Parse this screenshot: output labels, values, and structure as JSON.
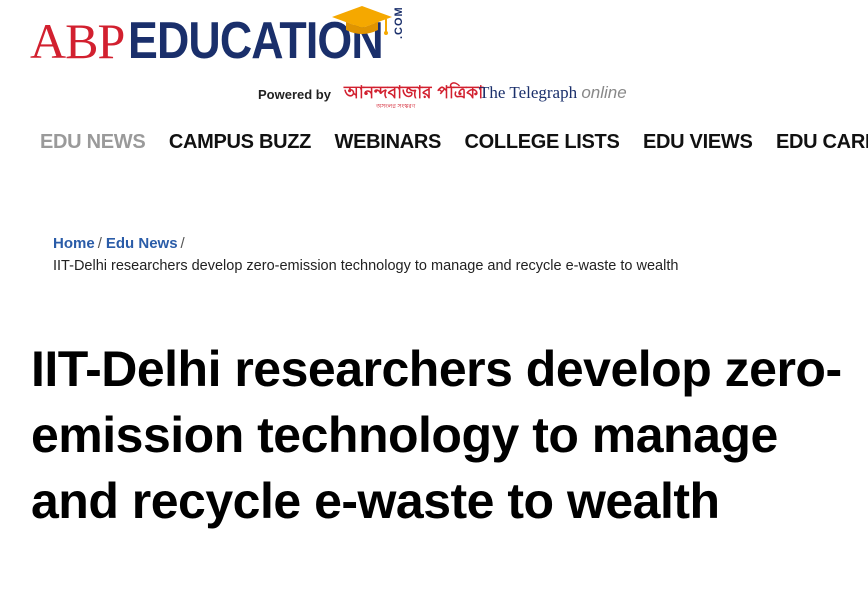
{
  "logo": {
    "abp": "ABP",
    "education": "EDUCATION",
    "com": ".COM",
    "accent_color": "#d2202f",
    "brand_color": "#1a2f6b",
    "cap_color": "#f5a800"
  },
  "powered_by": {
    "label": "Powered by",
    "anandabazar": "আনন্দবাজার পত্রিকা",
    "anandabazar_tag": "অসংলগ্ন সংস্করণ",
    "telegraph": "The Telegraph",
    "telegraph_online": "online"
  },
  "nav": {
    "items": [
      {
        "label": "EDU NEWS",
        "active": true
      },
      {
        "label": "CAMPUS BUZZ"
      },
      {
        "label": "WEBINARS"
      },
      {
        "label": "COLLEGE LISTS"
      },
      {
        "label": "EDU VIEWS"
      },
      {
        "label": "EDU CARE"
      }
    ]
  },
  "breadcrumb": {
    "home": "Home",
    "section": "Edu News",
    "current": "IIT-Delhi researchers develop zero-emission technology to manage and recycle e-waste to wealth"
  },
  "article": {
    "headline": "IIT-Delhi researchers develop zero-emission technology to manage and recycle e-waste to wealth"
  }
}
